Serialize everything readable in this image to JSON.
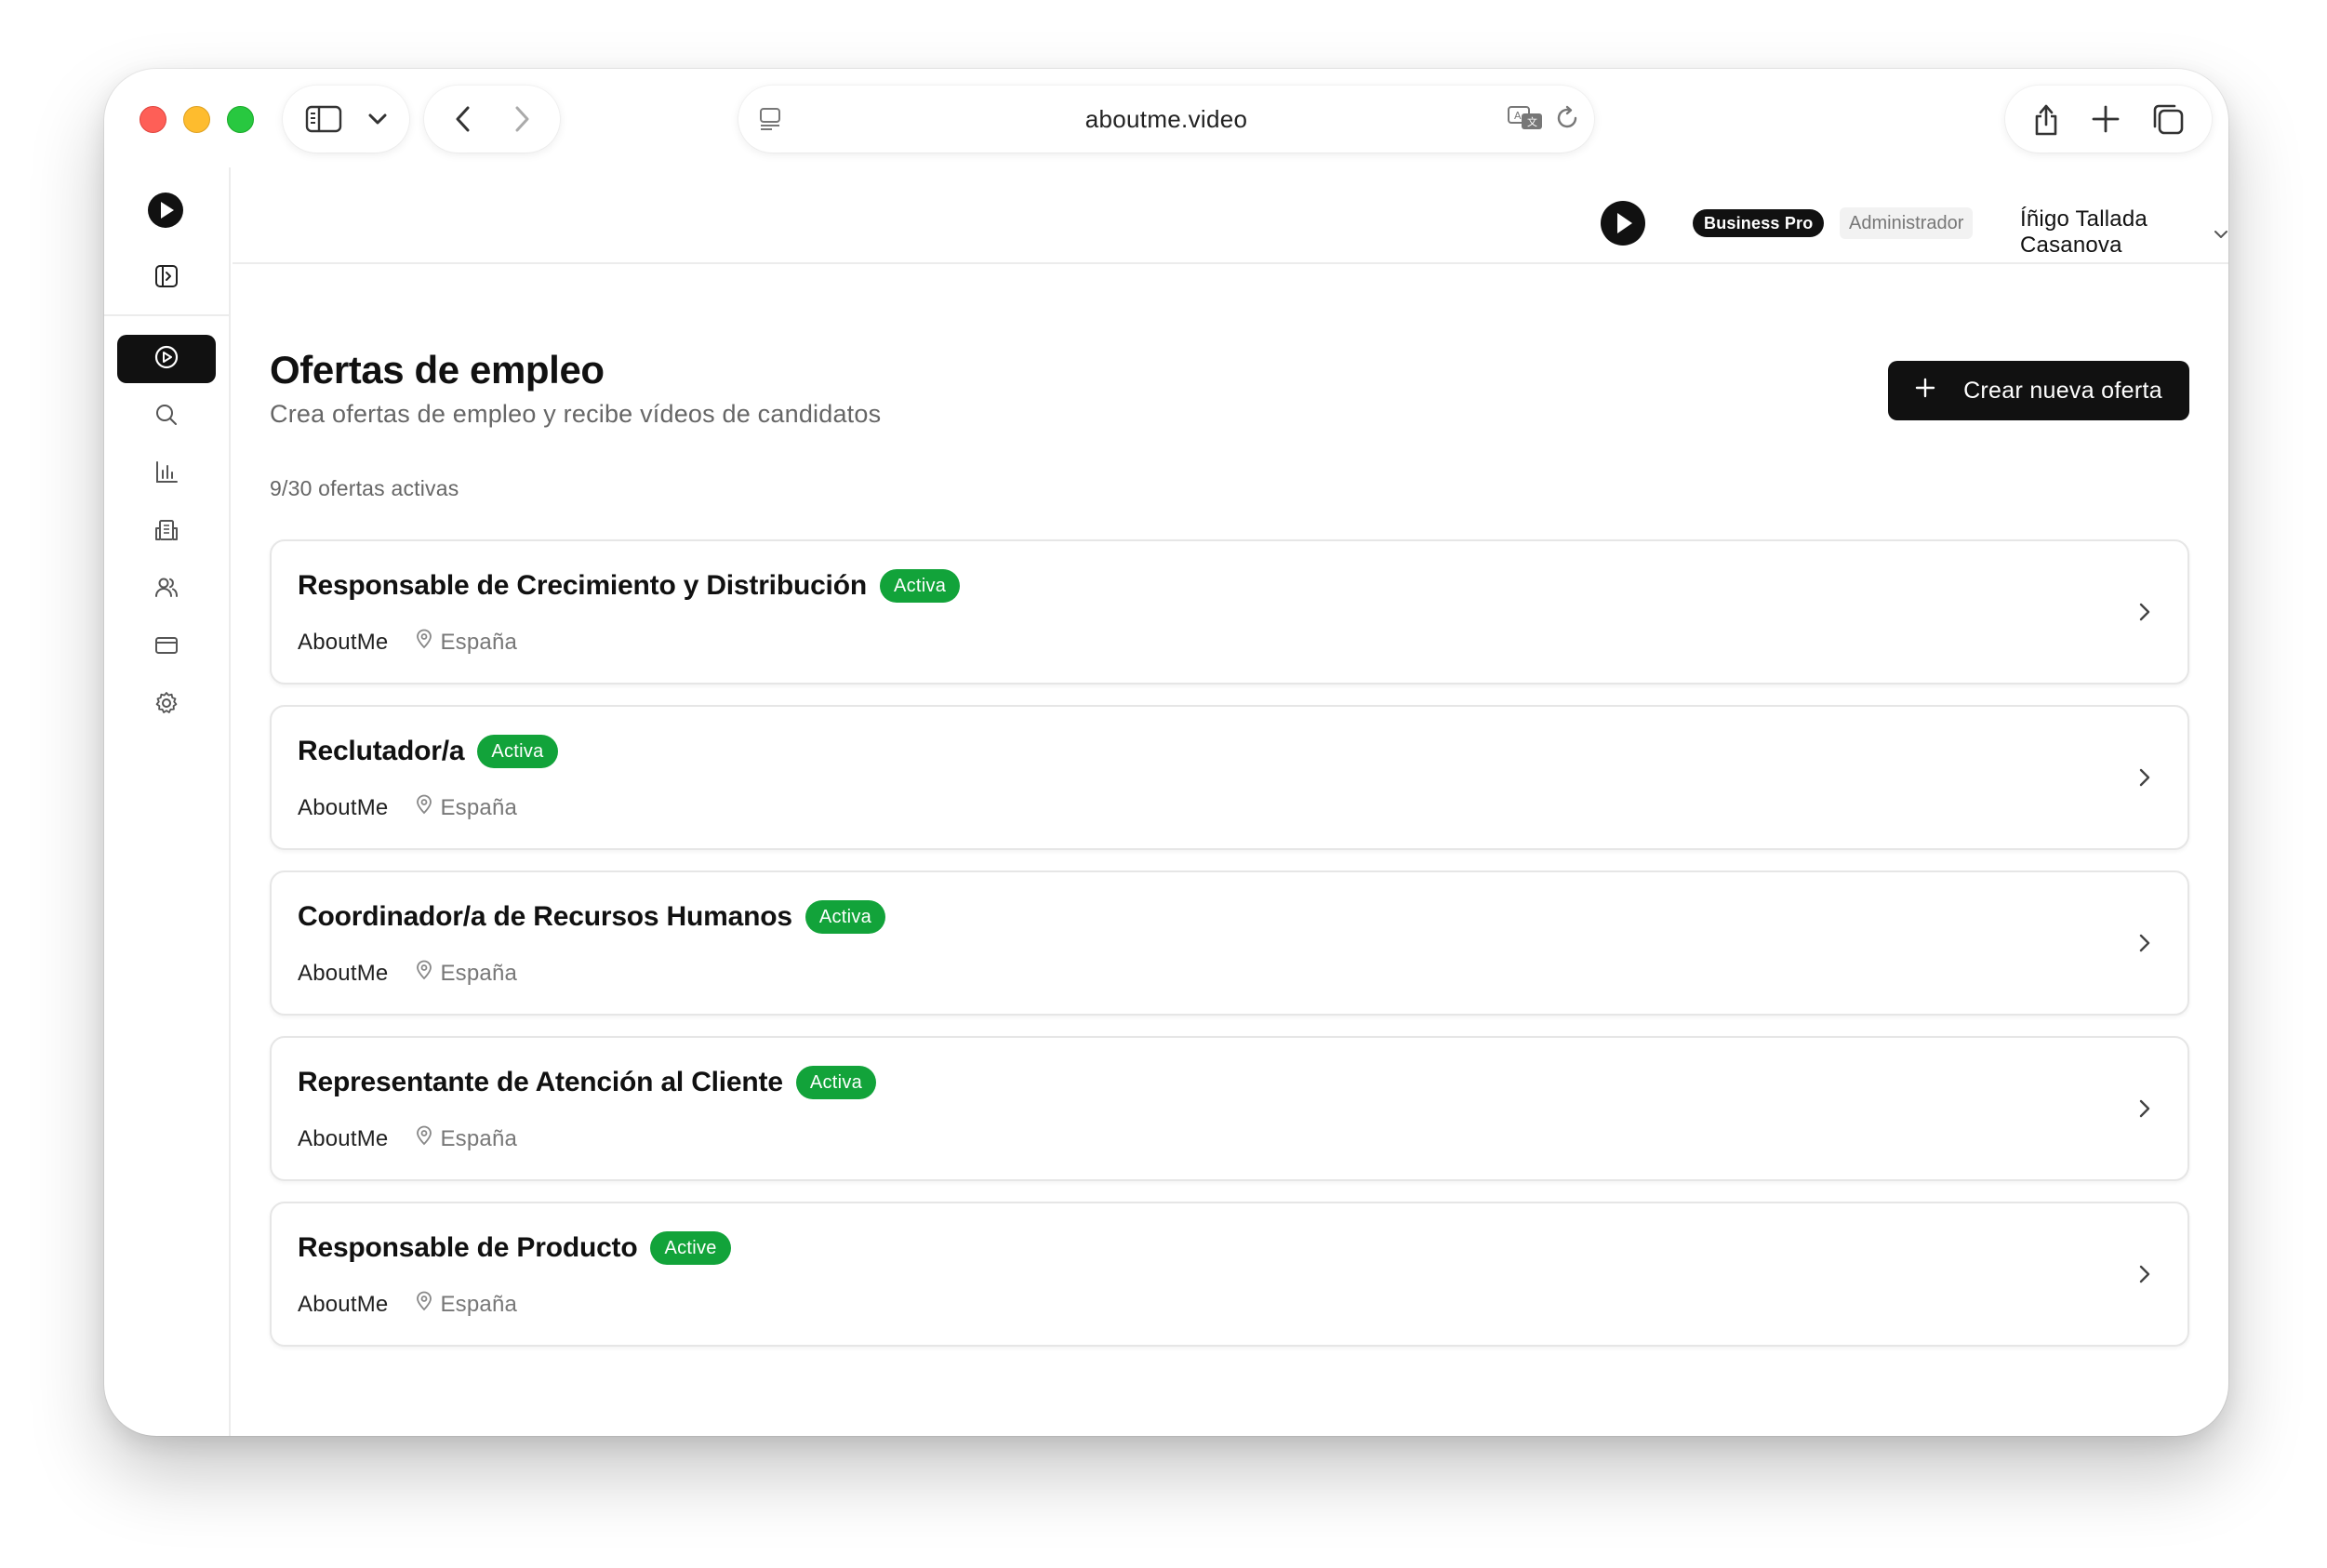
{
  "browser": {
    "url": "aboutme.video",
    "icons": {
      "sidebar_toggle": "sidebar-icon",
      "dropdown": "chevron-down-icon",
      "back": "chevron-left-icon",
      "forward": "chevron-right-icon",
      "page_menu": "page-menu-icon",
      "translate": "translate-icon",
      "reload": "reload-icon",
      "share": "share-icon",
      "new_tab": "plus-icon",
      "tabs": "tabs-icon"
    }
  },
  "sidebar": {
    "items": [
      {
        "name": "videos",
        "icon": "play-circle-icon",
        "active": true
      },
      {
        "name": "search",
        "icon": "search-icon",
        "active": false
      },
      {
        "name": "analytics",
        "icon": "bar-chart-icon",
        "active": false
      },
      {
        "name": "company",
        "icon": "building-icon",
        "active": false
      },
      {
        "name": "users",
        "icon": "users-icon",
        "active": false
      },
      {
        "name": "billing",
        "icon": "credit-card-icon",
        "active": false
      },
      {
        "name": "settings",
        "icon": "gear-icon",
        "active": false
      }
    ]
  },
  "header": {
    "plan_badge": "Business Pro",
    "role_badge": "Administrador",
    "user_name": "Íñigo Tallada Casanova"
  },
  "page": {
    "title": "Ofertas de empleo",
    "subtitle": "Crea ofertas de empleo y recibe vídeos de candidatos",
    "create_button": "Crear nueva oferta",
    "active_count": "9/30 ofertas activas"
  },
  "jobs": [
    {
      "title": "Responsable de Crecimiento y Distribución",
      "status": "Activa",
      "company": "AboutMe",
      "location": "España"
    },
    {
      "title": "Reclutador/a",
      "status": "Activa",
      "company": "AboutMe",
      "location": "España"
    },
    {
      "title": "Coordinador/a de Recursos Humanos",
      "status": "Activa",
      "company": "AboutMe",
      "location": "España"
    },
    {
      "title": "Representante de Atención al Cliente",
      "status": "Activa",
      "company": "AboutMe",
      "location": "España"
    },
    {
      "title": "Responsable de Producto",
      "status": "Active",
      "company": "AboutMe",
      "location": "España"
    }
  ],
  "colors": {
    "accent": "#111111",
    "status_green": "#12a33a",
    "muted_text": "#666666"
  }
}
